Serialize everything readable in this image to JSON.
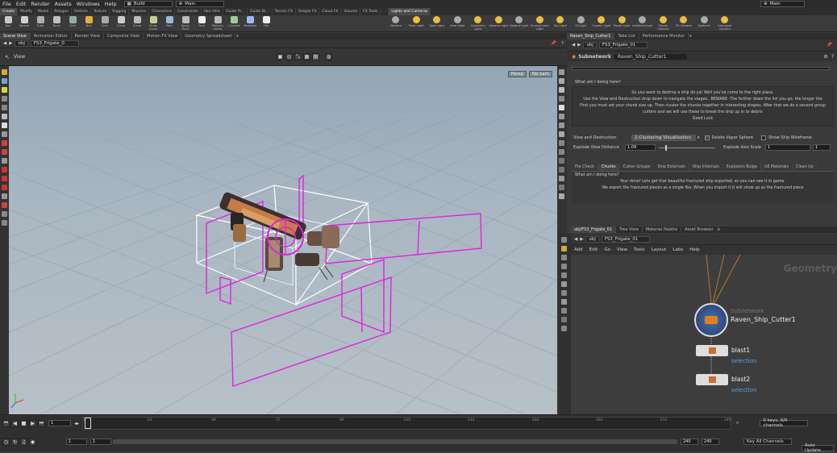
{
  "menubar": {
    "items": [
      "File",
      "Edit",
      "Render",
      "Assets",
      "Windows",
      "Help"
    ],
    "desktop": "Build",
    "context": "Main",
    "right_context": "Main"
  },
  "shelf_tabs": [
    "Create",
    "Modify",
    "Model",
    "Polygon",
    "Deform",
    "Texture",
    "Rigging",
    "Muscles",
    "Characters",
    "Constraints",
    "Hair Utils",
    "Guide Pr...",
    "Guide Br...",
    "Terrain FX",
    "Simple FX",
    "Cloud FX",
    "Volume",
    "FX Tools"
  ],
  "shelf_tabs_right": [
    "Lights and Cameras"
  ],
  "shelf_tools": [
    "Box",
    "Sphere",
    "Tube",
    "Torus",
    "Grid",
    "Null",
    "Line",
    "Circle",
    "Curve",
    "Draw Curve",
    "Path",
    "Spray Paint",
    "Font",
    "Platonic Solids",
    "L-System",
    "Metaball",
    "File"
  ],
  "light_tools": [
    "Camera",
    "Point Light",
    "Spot Light",
    "Area Light",
    "Geometry Light",
    "Volume Light",
    "Distant Light",
    "Environment Light",
    "Sky Light",
    "GI Light",
    "Caustic Light",
    "Portal Light",
    "Ambient Light",
    "Stereo Camera",
    "VR Camera",
    "Switcher",
    "Gamepad Camera"
  ],
  "left_tabs": [
    "Scene View",
    "Animation Editor",
    "Render View",
    "Composite View",
    "Motion FX View",
    "Geometry Spreadsheet"
  ],
  "left_path": {
    "obj": "obj",
    "node": "FS3_Frigate_0"
  },
  "view_label": "View",
  "viewport_menus": {
    "persp": "Persp",
    "cam": "No cam"
  },
  "right_tabs": [
    "Raven_Ship_Cutter1",
    "Take List",
    "Performance Monitor"
  ],
  "right_path": {
    "obj": "obj",
    "node": "FS3_Frigate_01"
  },
  "subnet": {
    "type": "Subnetwork",
    "name": "Raven_Ship_Cutter1"
  },
  "params": {
    "q1": "What am I doing here?",
    "lines": [
      "So you want to destroy a ship do ya! Well you've come to the right place.",
      "Use the View and Destruction drop down to navigate the stages.. BEWARE- The further down the list you go, the longer the",
      "First you must set your chunk size up. Then cluster the chunks together in interesting shapes. After that we do a second group",
      "cutters and we will use these to break the ship up in to debris",
      "Good Luck"
    ],
    "view_destr_label": "View and Destruction",
    "view_destr_value": "2-Clustering Visualisation",
    "delete_vapor": "Delete Vapor Sphere",
    "show_wire": "Show Ship Wireframe",
    "explode_dist_label": "Explode View Distance",
    "explode_dist_value": "1.09",
    "explode_axis_label": "Explode Axis Scale",
    "explode_axis_value": "1",
    "explode_axis_value2": "1",
    "tabs": [
      "Pre Check",
      "Chunks",
      "Cutter Groups",
      "Ship Externals",
      "Ship Internals",
      "Explosion Bulge",
      "UE Materials",
      "Clean Up"
    ],
    "q2": "What am I doing here?",
    "lines2": [
      "Your done! Lets get that beautiful fractured ship exported, so you can see it in game.",
      "We export the fractured pieces as a single fbx. When you import it it will show up as the fractured piece"
    ]
  },
  "net_tabs": [
    "obj/FS3_Frigate_01",
    "Tree View",
    "Material Palette",
    "Asset Browser"
  ],
  "net_path": {
    "obj": "obj",
    "node": "FS3_Frigate_01"
  },
  "net_menu": [
    "Add",
    "Edit",
    "Go",
    "View",
    "Tools",
    "Layout",
    "Labs",
    "Help"
  ],
  "net_watermark": "Geometry",
  "nodes": [
    {
      "type": "Subnetwork",
      "name": "Raven_Ship_Cutter1"
    },
    {
      "name": "blast1",
      "sub": "selection"
    },
    {
      "name": "blast2",
      "sub": "selection"
    }
  ],
  "timeline": {
    "frame": "1",
    "ticks": [
      "1",
      "24",
      "48",
      "72",
      "96",
      "120",
      "144",
      "168",
      "192",
      "216",
      "240"
    ],
    "start": "1",
    "start2": "1",
    "end": "240",
    "end2": "240",
    "keys": "0 keys, 0/0 channels",
    "key_all": "Key All Channels",
    "auto": "Auto Update"
  },
  "colors": {
    "magenta": "#e022e0",
    "viewport_top": "#93a6b6"
  }
}
